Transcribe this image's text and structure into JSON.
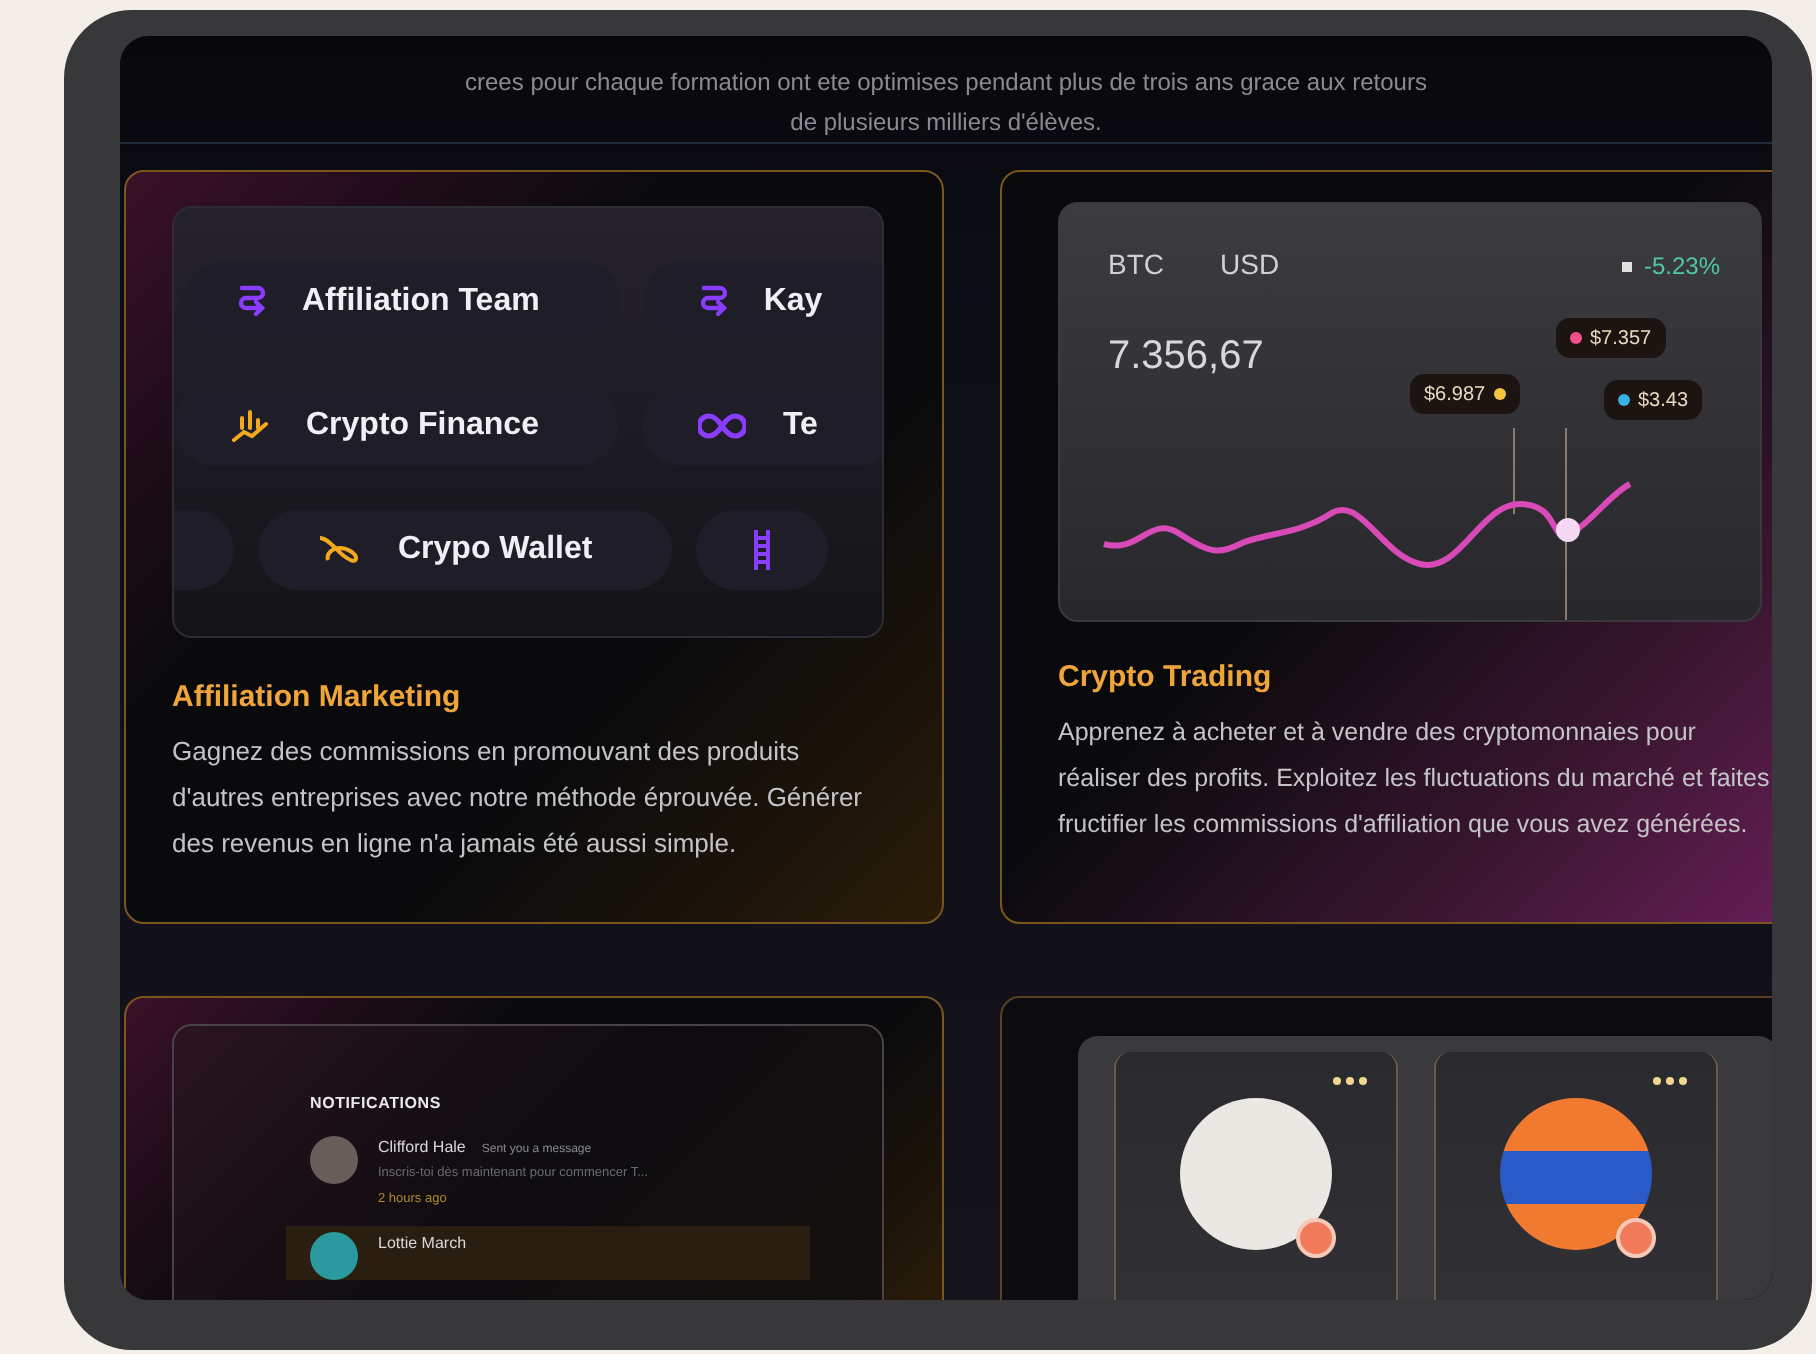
{
  "intro_lines": [
    "crees pour chaque formation ont ete optimises pendant plus de trois ans grace aux retours",
    "de plusieurs milliers d'élèves."
  ],
  "affiliation": {
    "pill_rows": [
      [
        {
          "kind": "team",
          "label": "Affiliation Team"
        },
        {
          "kind": "team",
          "label": "Kay"
        }
      ],
      [
        {
          "kind": "finance",
          "label": "Crypto Finance"
        },
        {
          "kind": "infinity",
          "label": "Te"
        }
      ],
      [
        {
          "kind": "blank"
        },
        {
          "kind": "wallet",
          "label": "Crypo Wallet"
        },
        {
          "kind": "ladder"
        }
      ]
    ],
    "title": "Affiliation Marketing",
    "description": "Gagnez des commissions en promouvant des produits d'autres entreprises avec notre méthode éprouvée. Générer des revenus en ligne n'a jamais été aussi simple."
  },
  "trading": {
    "base": "BTC",
    "quote": "USD",
    "change": "-5.23%",
    "price": "7.356,67",
    "tags": [
      {
        "text": "$7.357",
        "color": "#f0508c"
      },
      {
        "text": "$6.987",
        "color": "#f5c542"
      },
      {
        "text": "$3.43",
        "color": "#3bb0e0"
      }
    ],
    "title": "Crypto Trading",
    "description": "Apprenez à acheter et à vendre des cryptomonnaies pour réaliser des profits. Exploitez les fluctuations du marché et faites fructifier les commissions d'affiliation que vous avez générées."
  },
  "notifications": {
    "heading": "NOTIFICATIONS",
    "items": [
      {
        "name": "Clifford Hale",
        "action": "Sent you a message",
        "preview": "Inscris-toi dès maintenant pour commencer T...",
        "time": "2 hours ago",
        "selected": false
      },
      {
        "name": "Lottie March",
        "selected": true
      }
    ]
  },
  "profiles": [
    {
      "kind": "light"
    },
    {
      "kind": "orange"
    }
  ]
}
